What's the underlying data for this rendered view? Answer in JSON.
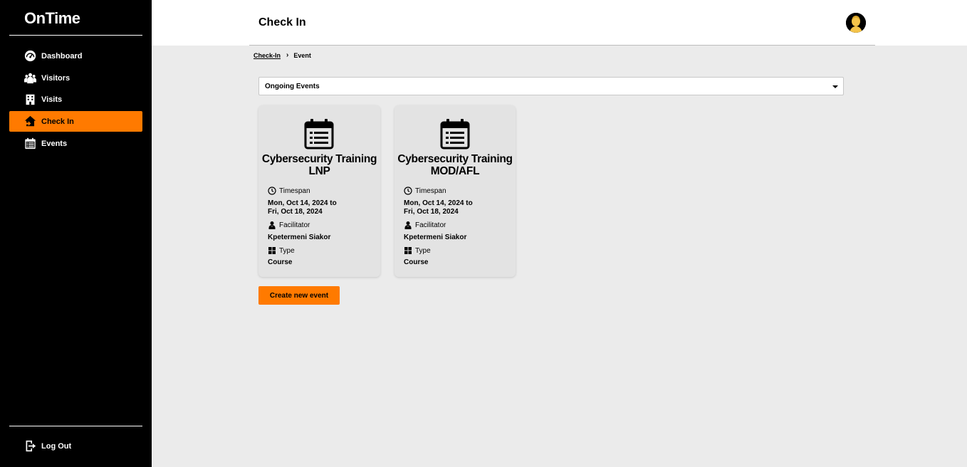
{
  "app": {
    "name": "OnTime"
  },
  "sidebar": {
    "items": [
      {
        "label": "Dashboard",
        "icon": "dashboard-icon"
      },
      {
        "label": "Visitors",
        "icon": "visitors-icon"
      },
      {
        "label": "Visits",
        "icon": "building-icon"
      },
      {
        "label": "Check In",
        "icon": "check-in-icon",
        "active": true
      },
      {
        "label": "Events",
        "icon": "calendar-icon"
      }
    ],
    "logout_label": "Log Out"
  },
  "header": {
    "title": "Check In",
    "avatar": "user-avatar"
  },
  "breadcrumb": {
    "link": "Check-In",
    "separator": "›",
    "current": "Event"
  },
  "filter": {
    "selected": "Ongoing Events"
  },
  "events": [
    {
      "title": "Cybersecurity Training LNP",
      "timespan_label": "Timespan",
      "timespan_start": "Mon, Oct 14, 2024 to",
      "timespan_end": "Fri, Oct 18, 2024",
      "facilitator_label": "Facilitator",
      "facilitator": "Kpetermeni Siakor",
      "type_label": "Type",
      "type": "Course"
    },
    {
      "title": "Cybersecurity Training MOD/AFL",
      "timespan_label": "Timespan",
      "timespan_start": "Mon, Oct 14, 2024 to",
      "timespan_end": "Fri, Oct 18, 2024",
      "facilitator_label": "Facilitator",
      "facilitator": "Kpetermeni Siakor",
      "type_label": "Type",
      "type": "Course"
    }
  ],
  "actions": {
    "create_label": "Create new event"
  },
  "colors": {
    "accent": "#ff7a00",
    "sidebar_bg": "#000000",
    "content_bg": "#ebebeb"
  }
}
